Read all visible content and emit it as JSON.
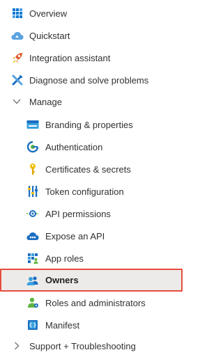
{
  "nav": {
    "top_items": [
      {
        "label": "Overview",
        "icon": "overview-grid-icon"
      },
      {
        "label": "Quickstart",
        "icon": "quickstart-cloud-icon"
      },
      {
        "label": "Integration assistant",
        "icon": "rocket-icon"
      },
      {
        "label": "Diagnose and solve problems",
        "icon": "wrench-icon"
      }
    ],
    "manage": {
      "label": "Manage",
      "expanded": true,
      "items": [
        {
          "label": "Branding & properties",
          "icon": "branding-card-icon"
        },
        {
          "label": "Authentication",
          "icon": "authentication-icon"
        },
        {
          "label": "Certificates & secrets",
          "icon": "key-icon"
        },
        {
          "label": "Token configuration",
          "icon": "token-bars-icon"
        },
        {
          "label": "API permissions",
          "icon": "api-permissions-icon"
        },
        {
          "label": "Expose an API",
          "icon": "expose-api-cloud-icon"
        },
        {
          "label": "App roles",
          "icon": "app-roles-grid-icon"
        },
        {
          "label": "Owners",
          "icon": "owners-people-icon",
          "selected": true
        },
        {
          "label": "Roles and administrators",
          "icon": "roles-admin-person-icon"
        },
        {
          "label": "Manifest",
          "icon": "manifest-icon"
        }
      ]
    },
    "support": {
      "label": "Support + Troubleshooting",
      "expanded": false
    }
  },
  "colors": {
    "selected_bg": "#edebe9",
    "selected_outline": "#e74c3c",
    "azure_blue": "#0078d4"
  }
}
